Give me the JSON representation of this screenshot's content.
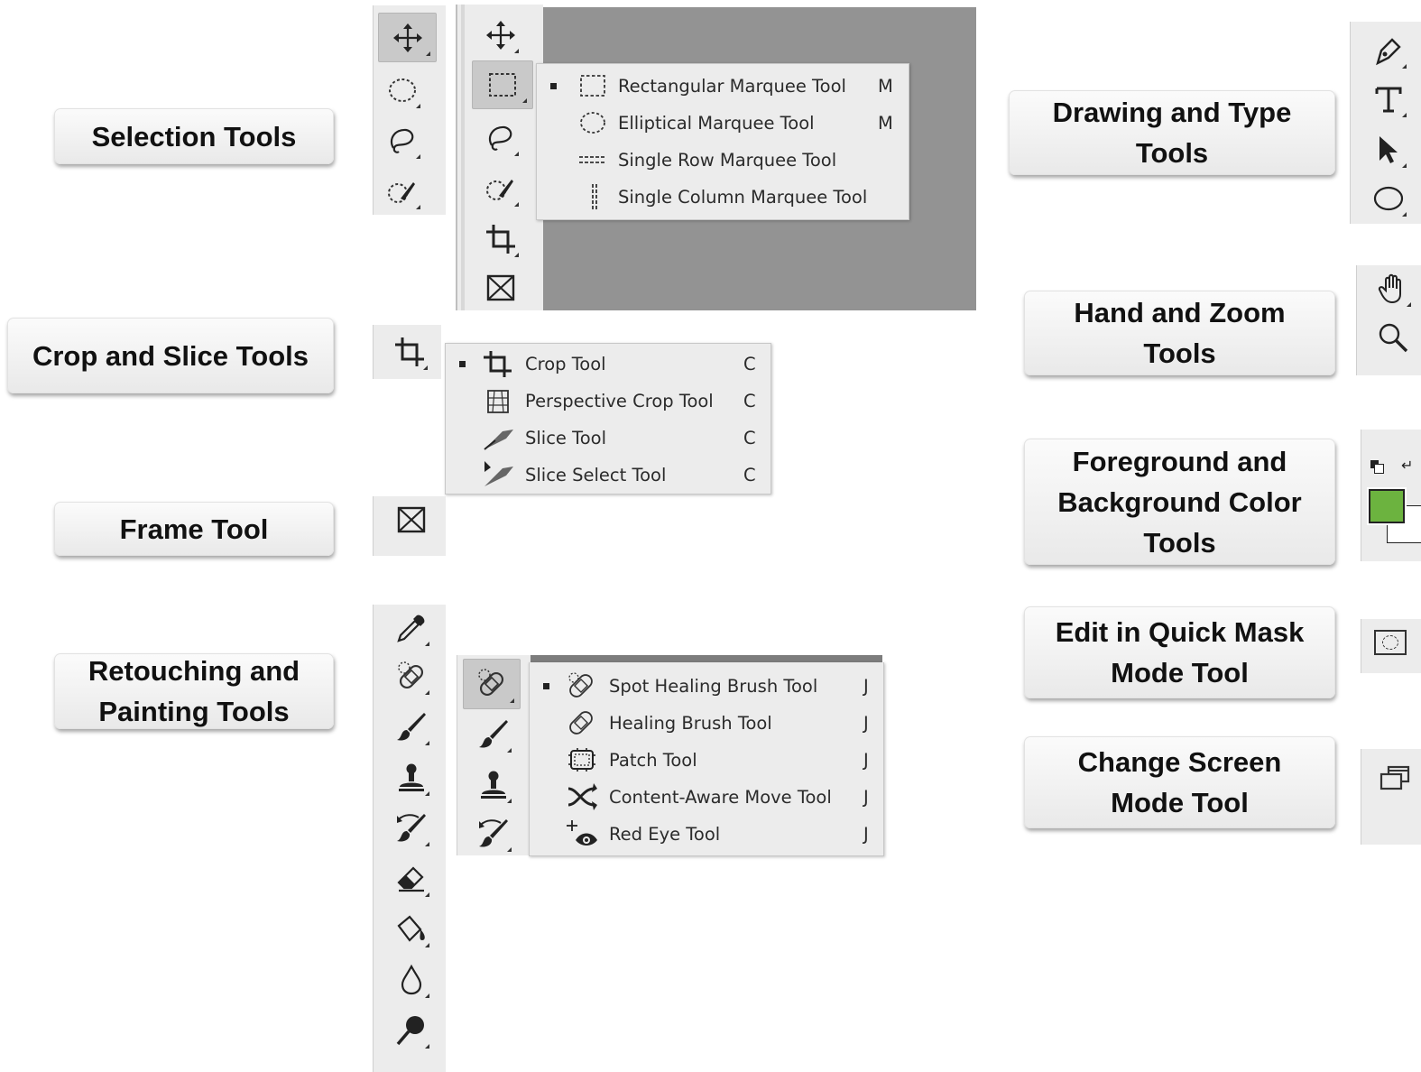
{
  "labels": {
    "selection": "Selection Tools",
    "crop_slice": "Crop and Slice Tools",
    "frame": "Frame Tool",
    "retouching_line1": "Retouching and",
    "retouching_line2": "Painting Tools",
    "drawing_line1": "Drawing and Type",
    "drawing_line2": "Tools",
    "hand_zoom_line1": "Hand and Zoom",
    "hand_zoom_line2": "Tools",
    "fgbg_line1": "Foreground and",
    "fgbg_line2": "Background Color",
    "fgbg_line3": "Tools",
    "quickmask_line1": "Edit in Quick Mask",
    "quickmask_line2": "Mode Tool",
    "screenmode_line1": "Change Screen",
    "screenmode_line2": "Mode Tool"
  },
  "marquee_flyout": [
    {
      "name": "Rectangular Marquee Tool",
      "key": "M",
      "icon": "rectangular-marquee-icon",
      "selected": true
    },
    {
      "name": "Elliptical Marquee Tool",
      "key": "M",
      "icon": "elliptical-marquee-icon",
      "selected": false
    },
    {
      "name": "Single Row Marquee Tool",
      "key": "",
      "icon": "single-row-marquee-icon",
      "selected": false
    },
    {
      "name": "Single Column Marquee Tool",
      "key": "",
      "icon": "single-column-marquee-icon",
      "selected": false
    }
  ],
  "crop_flyout": [
    {
      "name": "Crop Tool",
      "key": "C",
      "icon": "crop-icon",
      "selected": true
    },
    {
      "name": "Perspective Crop Tool",
      "key": "C",
      "icon": "perspective-crop-icon",
      "selected": false
    },
    {
      "name": "Slice Tool",
      "key": "C",
      "icon": "slice-icon",
      "selected": false
    },
    {
      "name": "Slice Select Tool",
      "key": "C",
      "icon": "slice-select-icon",
      "selected": false
    }
  ],
  "healing_flyout": [
    {
      "name": "Spot Healing Brush Tool",
      "key": "J",
      "icon": "spot-healing-brush-icon",
      "selected": true
    },
    {
      "name": "Healing Brush Tool",
      "key": "J",
      "icon": "healing-brush-icon",
      "selected": false
    },
    {
      "name": "Patch Tool",
      "key": "J",
      "icon": "patch-icon",
      "selected": false
    },
    {
      "name": "Content-Aware Move Tool",
      "key": "J",
      "icon": "content-aware-move-icon",
      "selected": false
    },
    {
      "name": "Red Eye Tool",
      "key": "J",
      "icon": "red-eye-icon",
      "selected": false
    }
  ],
  "colors": {
    "foreground": "#6cb33f",
    "canvas_gray": "#939393",
    "panel": "#ececec"
  }
}
